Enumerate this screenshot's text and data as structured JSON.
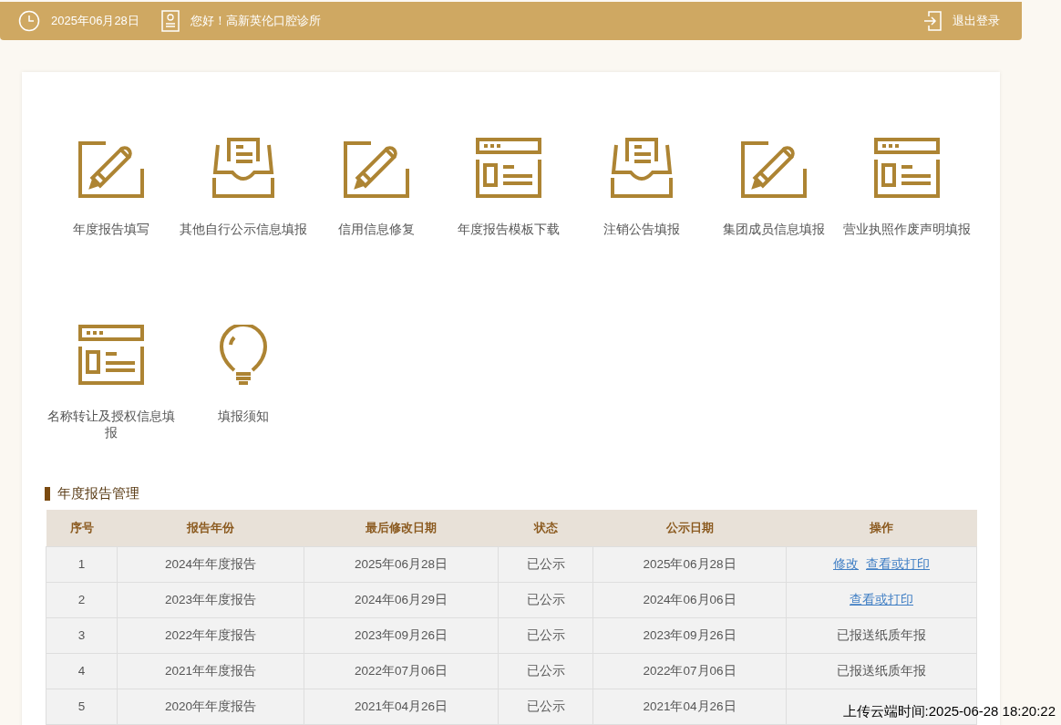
{
  "top_bar": {
    "date": "2025年06月28日",
    "greeting": "您好！高新英伦口腔诊所",
    "logout": "退出登录"
  },
  "tiles": [
    {
      "label": "年度报告填写",
      "kind": "pencil"
    },
    {
      "label": "其他自行公示信息填报",
      "kind": "tray"
    },
    {
      "label": "信用信息修复",
      "kind": "pencil"
    },
    {
      "label": "年度报告模板下载",
      "kind": "window"
    },
    {
      "label": "注销公告填报",
      "kind": "tray"
    },
    {
      "label": "集团成员信息填报",
      "kind": "pencil"
    },
    {
      "label": "营业执照作废声明填报",
      "kind": "window"
    },
    {
      "label": "名称转让及授权信息填报",
      "kind": "window"
    },
    {
      "label": "填报须知",
      "kind": "bulb"
    }
  ],
  "section_title": "年度报告管理",
  "table": {
    "columns": [
      "序号",
      "报告年份",
      "最后修改日期",
      "状态",
      "公示日期",
      "操作"
    ],
    "rows": [
      {
        "cells": [
          "1",
          "2024年年度报告",
          "2025年06月28日",
          "已公示",
          "2025年06月28日"
        ],
        "actions": [
          {
            "text": "修改",
            "kind": "link"
          },
          {
            "text": "查看或打印",
            "kind": "link"
          }
        ]
      },
      {
        "cells": [
          "2",
          "2023年年度报告",
          "2024年06月29日",
          "已公示",
          "2024年06月06日"
        ],
        "actions": [
          {
            "text": "查看或打印",
            "kind": "link"
          }
        ]
      },
      {
        "cells": [
          "3",
          "2022年年度报告",
          "2023年09月26日",
          "已公示",
          "2023年09月26日"
        ],
        "actions": [
          {
            "text": "已报送纸质年报",
            "kind": "text"
          }
        ]
      },
      {
        "cells": [
          "4",
          "2021年年度报告",
          "2022年07月06日",
          "已公示",
          "2022年07月06日"
        ],
        "actions": [
          {
            "text": "已报送纸质年报",
            "kind": "text"
          }
        ]
      },
      {
        "cells": [
          "5",
          "2020年年度报告",
          "2021年04月26日",
          "已公示",
          "2021年04月26日"
        ]
      }
    ]
  },
  "upload_time": "上传云端时间:2025-06-28 18:20:22"
}
